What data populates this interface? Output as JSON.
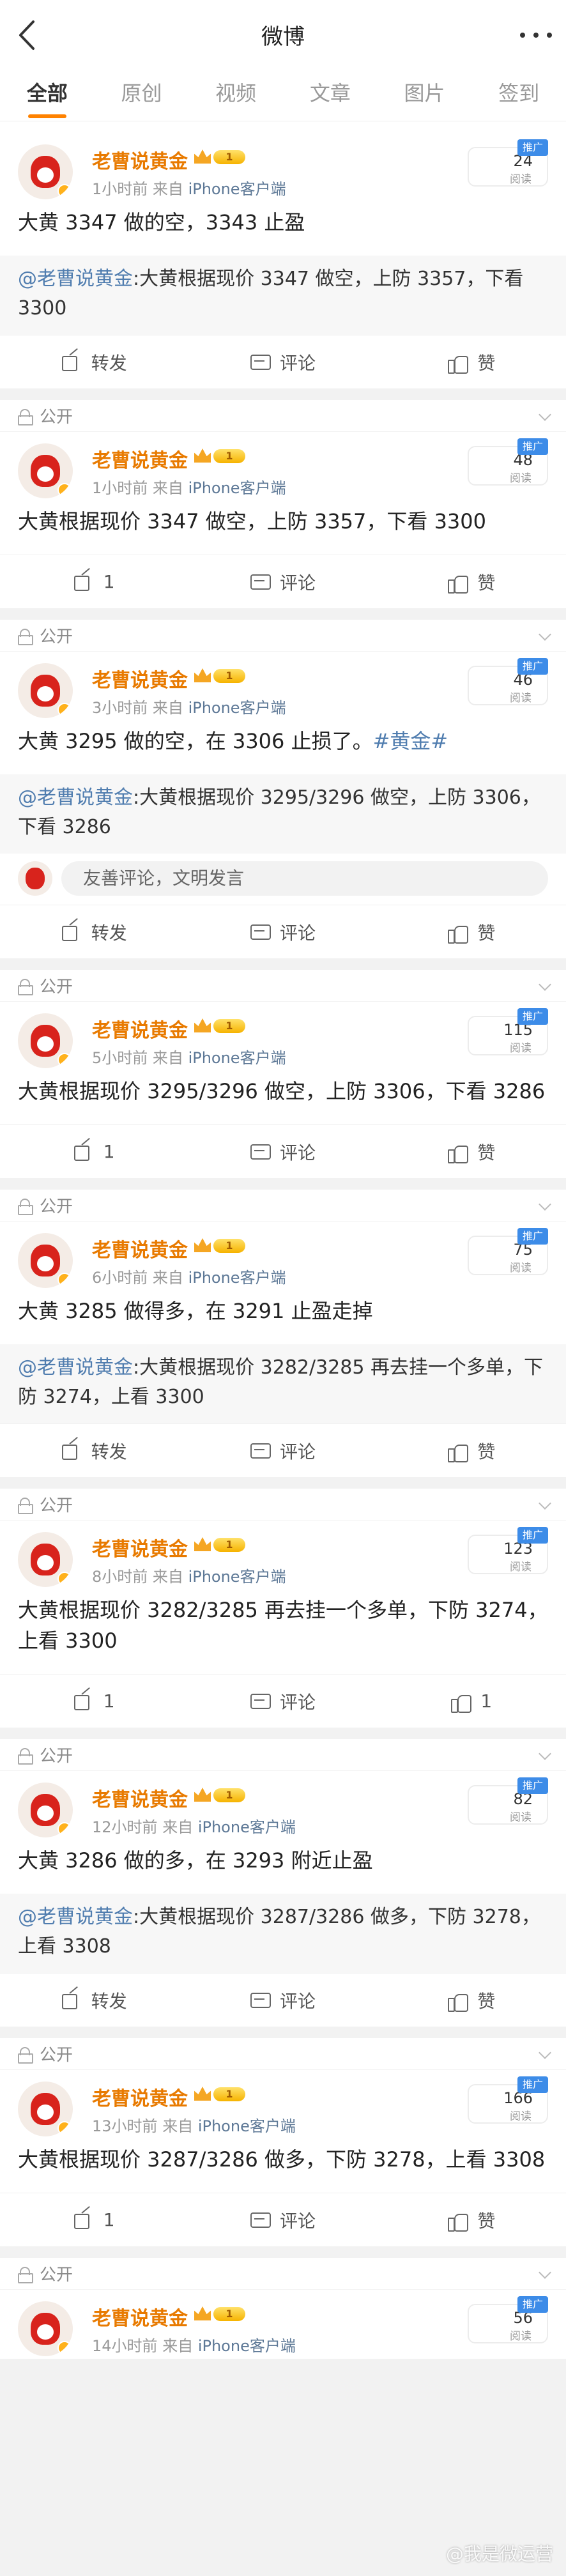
{
  "header": {
    "title": "微博"
  },
  "tabs": [
    "全部",
    "原创",
    "视频",
    "文章",
    "图片",
    "签到"
  ],
  "user": {
    "name": "老曹说黄金",
    "level": "1",
    "source_prefix": "来自",
    "source": "iPhone客户端"
  },
  "common": {
    "public_label": "公开",
    "reads_label": "阅读",
    "ad_label": "推广",
    "share_label": "转发",
    "comment_label": "评论",
    "like_label": "赞",
    "comment_placeholder": "友善评论，文明发言"
  },
  "posts": [
    {
      "time": "1小时前",
      "reads": "24",
      "text": "大黄 3347 做的空，3343 止盈",
      "tag": "",
      "quote_author": "@老曹说黄金",
      "quote": ":大黄根据现价 3347 做空，上防 3357，下看 3300",
      "share": "转发",
      "comment": "评论",
      "like": "赞"
    },
    {
      "time": "1小时前",
      "reads": "48",
      "text": "大黄根据现价 3347 做空，上防 3357，下看 3300",
      "tag": "",
      "quote_author": "",
      "quote": "",
      "share": "1",
      "comment": "评论",
      "like": "赞"
    },
    {
      "time": "3小时前",
      "reads": "46",
      "text": "大黄 3295 做的空，在 3306 止损了。",
      "tag": "#黄金#",
      "quote_author": "@老曹说黄金",
      "quote": ":大黄根据现价 3295/3296 做空，上防 3306，下看 3286",
      "share": "转发",
      "comment": "评论",
      "like": "赞"
    },
    {
      "time": "5小时前",
      "reads": "115",
      "text": "大黄根据现价 3295/3296 做空，上防 3306，下看 3286",
      "tag": "",
      "quote_author": "",
      "quote": "",
      "share": "1",
      "comment": "评论",
      "like": "赞"
    },
    {
      "time": "6小时前",
      "reads": "75",
      "text": "大黄 3285 做得多，在 3291 止盈走掉",
      "tag": "",
      "quote_author": "@老曹说黄金",
      "quote": ":大黄根据现价 3282/3285 再去挂一个多单，下防 3274，上看 3300",
      "share": "转发",
      "comment": "评论",
      "like": "赞"
    },
    {
      "time": "8小时前",
      "reads": "123",
      "text": "大黄根据现价 3282/3285 再去挂一个多单，下防 3274，上看 3300",
      "tag": "",
      "quote_author": "",
      "quote": "",
      "share": "1",
      "comment": "评论",
      "like": "1"
    },
    {
      "time": "12小时前",
      "reads": "82",
      "text": "大黄 3286 做的多，在 3293 附近止盈",
      "tag": "",
      "quote_author": "@老曹说黄金",
      "quote": ":大黄根据现价 3287/3286 做多，下防 3278，上看 3308",
      "share": "转发",
      "comment": "评论",
      "like": "赞"
    },
    {
      "time": "13小时前",
      "reads": "166",
      "text": "大黄根据现价 3287/3286 做多，下防 3278，上看 3308",
      "tag": "",
      "quote_author": "",
      "quote": "",
      "share": "1",
      "comment": "评论",
      "like": "赞"
    },
    {
      "time": "14小时前",
      "reads": "56",
      "text": "",
      "tag": "",
      "quote_author": "",
      "quote": "",
      "share": "",
      "comment": "",
      "like": ""
    }
  ],
  "watermark": "@我是微运营"
}
